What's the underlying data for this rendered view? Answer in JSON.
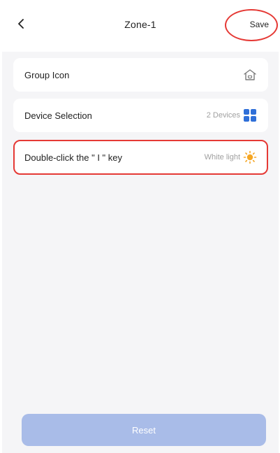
{
  "header": {
    "title": "Zone-1",
    "save_label": "Save"
  },
  "settings": {
    "items": [
      {
        "label": "Group Icon",
        "value": "",
        "icon": "home-icon"
      },
      {
        "label": "Device Selection",
        "value": "2 Devices",
        "icon": "grid-icon"
      },
      {
        "label": "Double-click the \" I \" key",
        "value": "White light",
        "icon": "sun-icon"
      }
    ]
  },
  "footer": {
    "reset_label": "Reset"
  },
  "colors": {
    "accent": "#2f6fd8",
    "highlight": "#e53935",
    "sun": "#f5a623",
    "reset_bg": "#a9bce8"
  }
}
